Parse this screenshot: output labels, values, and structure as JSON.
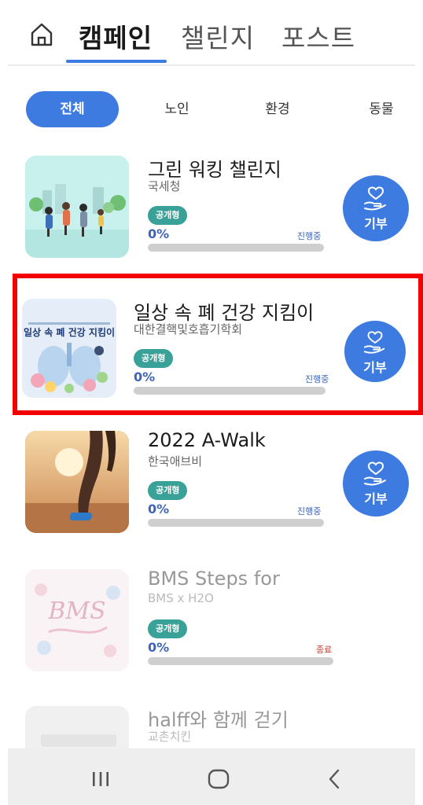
{
  "header": {
    "tabs": [
      {
        "label": "캠페인",
        "active": true
      },
      {
        "label": "챌린지",
        "active": false
      },
      {
        "label": "포스트",
        "active": false
      }
    ]
  },
  "categories": [
    {
      "label": "전체",
      "selected": true
    },
    {
      "label": "노인",
      "selected": false
    },
    {
      "label": "환경",
      "selected": false
    },
    {
      "label": "동물",
      "selected": false
    }
  ],
  "campaigns": [
    {
      "title": "그린 워킹 챌린지",
      "org": "국세청",
      "badge": "공개형",
      "percent_label": "0%",
      "progress": 0,
      "status": "진행중",
      "donate_label": "기부"
    },
    {
      "title": "일상 속 폐 건강 지킴이",
      "org": "대한결핵및호흡기학회",
      "badge": "공개형",
      "percent_label": "0%",
      "progress": 0,
      "status": "진행중",
      "donate_label": "기부",
      "thumb_text": "일상 속 폐 건강 지킴이"
    },
    {
      "title": "2022 A-Walk",
      "org": "한국애브비",
      "badge": "공개형",
      "percent_label": "0%",
      "progress": 0,
      "status": "진행중",
      "donate_label": "기부"
    },
    {
      "title": "BMS Steps for",
      "org": "BMS x H2O",
      "badge": "공개형",
      "percent_label": "0%",
      "progress": 0,
      "status": "종료",
      "thumb_text": "BMS"
    },
    {
      "title": "halff와 함께 걷기",
      "org": "교촌치킨"
    }
  ],
  "colors": {
    "accent": "#3e7be0",
    "badge": "#3aa198",
    "highlight": "#f20000",
    "ended": "#c0392b"
  }
}
